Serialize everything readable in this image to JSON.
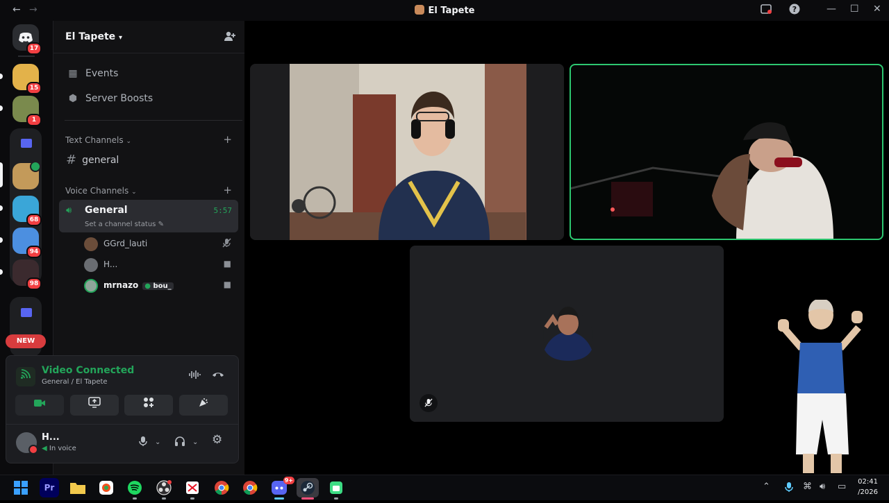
{
  "window": {
    "title": "El Tapete",
    "back_glyph": "←",
    "forward_glyph": "→",
    "inbox_icon": "inbox-icon",
    "help_icon": "help-icon",
    "minimize_glyph": "—",
    "maximize_glyph": "☐",
    "close_glyph": "✕"
  },
  "rail": {
    "dm_badge": "17",
    "servers": [
      {
        "name": "server-1",
        "badge": "15",
        "color": "#e3b24a"
      },
      {
        "name": "server-2",
        "badge": "1",
        "color": "#7a8a4d"
      },
      {
        "name": "server-3",
        "badge": "",
        "color": "#c39a5a"
      },
      {
        "name": "server-4",
        "badge": "68",
        "color": "#3aa6d8"
      },
      {
        "name": "server-5",
        "badge": "94",
        "color": "#4c8fe0"
      },
      {
        "name": "server-6",
        "badge": "98",
        "color": "#3b2a2e"
      }
    ],
    "new_label": "NEW"
  },
  "sidebar": {
    "server_name": "El Tapete",
    "items": [
      {
        "label": "Events",
        "icon": "calendar-icon"
      },
      {
        "label": "Server Boosts",
        "icon": "boost-icon"
      }
    ],
    "text_category": "Text Channels",
    "text_channels": [
      {
        "name": "general"
      }
    ],
    "voice_category": "Voice Channels",
    "voice_channel": {
      "name": "General",
      "time": "5:57",
      "status": "Set a channel status"
    },
    "voice_users": [
      {
        "name": "GGrd_lauti",
        "state": "muted-icon",
        "tag": "",
        "avatar_color": "#6b4d3a"
      },
      {
        "name": "H...",
        "state": "video-icon",
        "tag": "",
        "avatar_color": "#6a6d72"
      },
      {
        "name": "mrnazo",
        "state": "video-icon",
        "tag": "bou_",
        "avatar_color": "#8fa69a"
      }
    ]
  },
  "voice_panel": {
    "title": "Video Connected",
    "subtitle": "General / El Tapete",
    "buttons": [
      {
        "name": "camera-button",
        "icon": "video-camera-icon",
        "active": true
      },
      {
        "name": "share-screen-button",
        "icon": "screen-share-icon",
        "active": false
      },
      {
        "name": "activities-button",
        "icon": "activities-icon",
        "active": false
      },
      {
        "name": "soundboard-button",
        "icon": "soundboard-icon",
        "active": false
      }
    ]
  },
  "user": {
    "name": "H...",
    "status": "In voice"
  },
  "tiles": [
    {
      "name": "video-tile-left",
      "speaking": false,
      "muted": false
    },
    {
      "name": "video-tile-right",
      "speaking": true,
      "muted": false
    },
    {
      "name": "video-tile-avatar",
      "speaking": false,
      "muted": true
    }
  ],
  "taskbar": {
    "apps": [
      {
        "name": "start-button",
        "icon": "windows-icon"
      },
      {
        "name": "premiere-app",
        "icon": "premiere-icon",
        "label": "Pr"
      },
      {
        "name": "file-explorer-app",
        "icon": "folder-icon"
      },
      {
        "name": "photos-app",
        "icon": "photos-icon"
      },
      {
        "name": "spotify-app",
        "icon": "spotify-icon"
      },
      {
        "name": "obs-app",
        "icon": "obs-icon"
      },
      {
        "name": "snipping-app",
        "icon": "snipping-icon"
      },
      {
        "name": "chrome-app-1",
        "icon": "chrome-icon"
      },
      {
        "name": "chrome-app-2",
        "icon": "chrome-icon"
      },
      {
        "name": "discord-app",
        "icon": "discord-icon",
        "badge": "9+"
      },
      {
        "name": "steam-app",
        "icon": "steam-icon"
      },
      {
        "name": "android-app",
        "icon": "android-icon"
      }
    ],
    "time": "02:41",
    "date": "/2026"
  },
  "colors": {
    "accent_green": "#23a55a",
    "badge_red": "#f23f42",
    "speaking_outline": "#2dc770"
  }
}
